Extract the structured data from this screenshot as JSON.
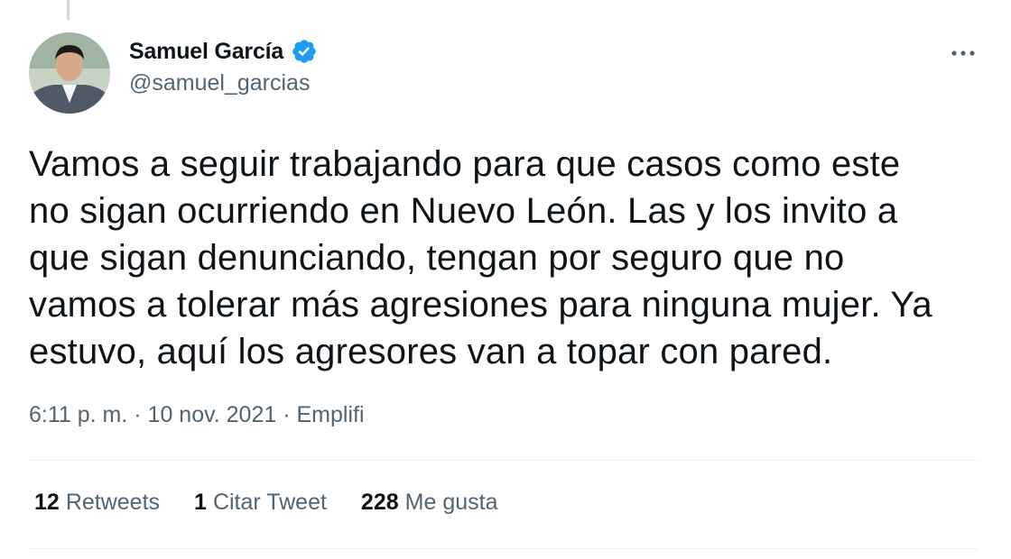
{
  "author": {
    "display_name": "Samuel García",
    "handle": "@samuel_garcias",
    "verified": true,
    "avatar_icon": "profile-photo"
  },
  "more_icon": "ellipsis-icon",
  "tweet": {
    "text": "Vamos a seguir trabajando para que casos como este\nno sigan ocurriendo en Nuevo León. Las y los invito a\nque sigan denunciando, tengan por seguro que no\nvamos a tolerar más agresiones para ninguna mujer. Ya\nestuvo, aquí los agresores van a topar con pared."
  },
  "meta": {
    "time": "6:11 p. m.",
    "sep1": " · ",
    "date": "10 nov. 2021",
    "sep2": " · ",
    "source": "Emplifi"
  },
  "stats": [
    {
      "count": "12",
      "label": "Retweets"
    },
    {
      "count": "1",
      "label": "Citar Tweet"
    },
    {
      "count": "228",
      "label": "Me gusta"
    }
  ],
  "colors": {
    "text": "#0f1419",
    "secondary": "#536471",
    "verified": "#1d9bf0",
    "divider": "#eff3f4"
  }
}
